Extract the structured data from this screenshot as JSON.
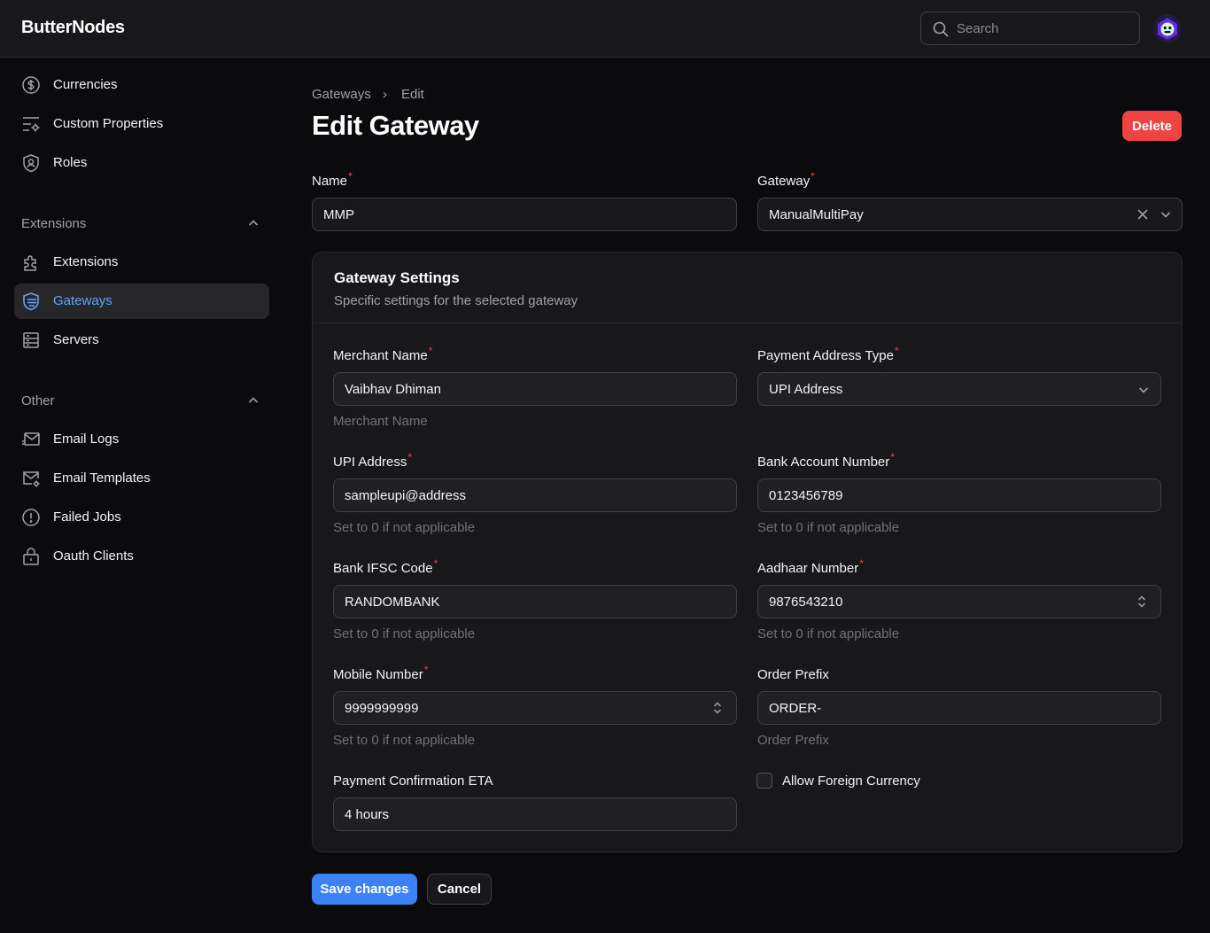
{
  "app": {
    "brand": "ButterNodes"
  },
  "search": {
    "placeholder": "Search"
  },
  "sidebar": {
    "items_top": [
      {
        "label": "Currencies",
        "icon": "currency-dollar-icon"
      },
      {
        "label": "Custom Properties",
        "icon": "adjustments-icon"
      },
      {
        "label": "Roles",
        "icon": "shield-user-icon"
      }
    ],
    "groups": [
      {
        "label": "Extensions",
        "items": [
          {
            "label": "Extensions",
            "icon": "puzzle-icon"
          },
          {
            "label": "Gateways",
            "icon": "gateway-icon",
            "active": true
          },
          {
            "label": "Servers",
            "icon": "server-icon"
          }
        ]
      },
      {
        "label": "Other",
        "items": [
          {
            "label": "Email Logs",
            "icon": "mail-send-icon"
          },
          {
            "label": "Email Templates",
            "icon": "mail-gear-icon"
          },
          {
            "label": "Failed Jobs",
            "icon": "alert-circle-icon"
          },
          {
            "label": "Oauth Clients",
            "icon": "lock-icon"
          }
        ]
      }
    ]
  },
  "breadcrumb": {
    "parent": "Gateways",
    "sep": "›",
    "current": "Edit"
  },
  "page": {
    "title": "Edit Gateway",
    "delete_label": "Delete"
  },
  "form": {
    "name_label": "Name",
    "name_value": "MMP",
    "gateway_label": "Gateway",
    "gateway_value": "ManualMultiPay",
    "required_mark": "*"
  },
  "settings": {
    "title": "Gateway Settings",
    "subtitle": "Specific settings for the selected gateway",
    "merchant_name": {
      "label": "Merchant Name",
      "value": "Vaibhav Dhiman",
      "hint": "Merchant Name"
    },
    "payment_address_type": {
      "label": "Payment Address Type",
      "value": "UPI Address"
    },
    "upi_address": {
      "label": "UPI Address",
      "value": "sampleupi@address",
      "hint": "Set to 0 if not applicable"
    },
    "bank_account": {
      "label": "Bank Account Number",
      "value": "0123456789",
      "hint": "Set to 0 if not applicable"
    },
    "bank_ifsc": {
      "label": "Bank IFSC Code",
      "value": "RANDOMBANK",
      "hint": "Set to 0 if not applicable"
    },
    "aadhaar": {
      "label": "Aadhaar Number",
      "value": "9876543210",
      "hint": "Set to 0 if not applicable"
    },
    "mobile": {
      "label": "Mobile Number",
      "value": "9999999999",
      "hint": "Set to 0 if not applicable"
    },
    "order_prefix": {
      "label": "Order Prefix",
      "value": "ORDER-",
      "hint": "Order Prefix"
    },
    "eta": {
      "label": "Payment Confirmation ETA",
      "value": "4 hours"
    },
    "allow_foreign": {
      "label": "Allow Foreign Currency",
      "checked": false
    }
  },
  "actions": {
    "save_label": "Save changes",
    "cancel_label": "Cancel"
  },
  "colors": {
    "accent": "#3b82f6",
    "danger": "#ef4444",
    "background": "#0b0b0d",
    "surface": "#18181b"
  }
}
